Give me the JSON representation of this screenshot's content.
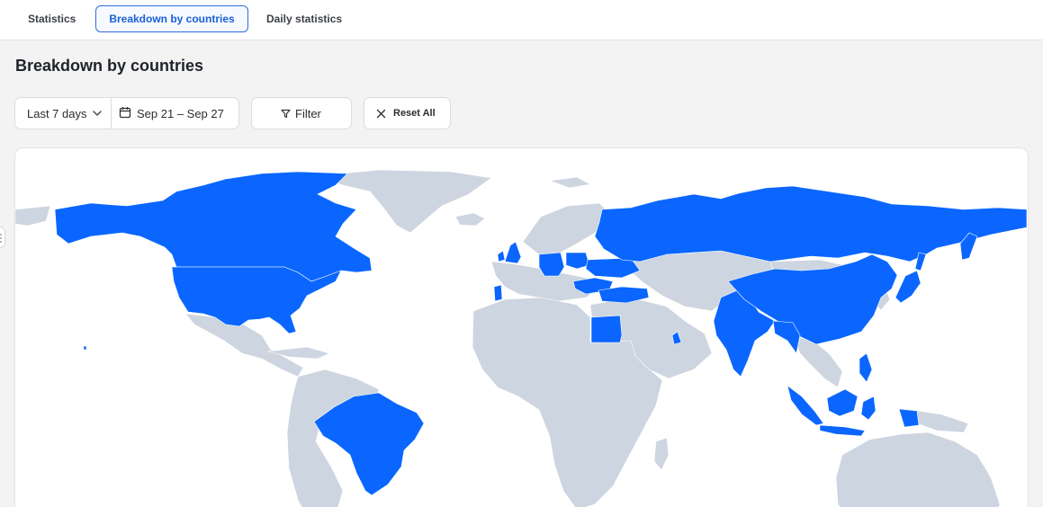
{
  "tabs": [
    {
      "label": "Statistics",
      "active": false
    },
    {
      "label": "Breakdown by countries",
      "active": true
    },
    {
      "label": "Daily statistics",
      "active": false
    }
  ],
  "page": {
    "title": "Breakdown by countries"
  },
  "toolbar": {
    "range_label": "Last 7 days",
    "date_range": "Sep 21 – Sep 27",
    "filter_label": "Filter",
    "reset_label": "Reset All"
  },
  "map": {
    "highlight_color": "#0a66ff",
    "base_color": "#cdd5e0",
    "highlighted_regions": [
      "canada",
      "united-states",
      "brazil",
      "united-kingdom",
      "germany",
      "portugal",
      "poland",
      "romania",
      "ukraine",
      "russia",
      "turkey",
      "egypt",
      "uae",
      "india",
      "china",
      "bangladesh",
      "myanmar",
      "thailand",
      "japan",
      "indonesia",
      "philippines"
    ]
  }
}
